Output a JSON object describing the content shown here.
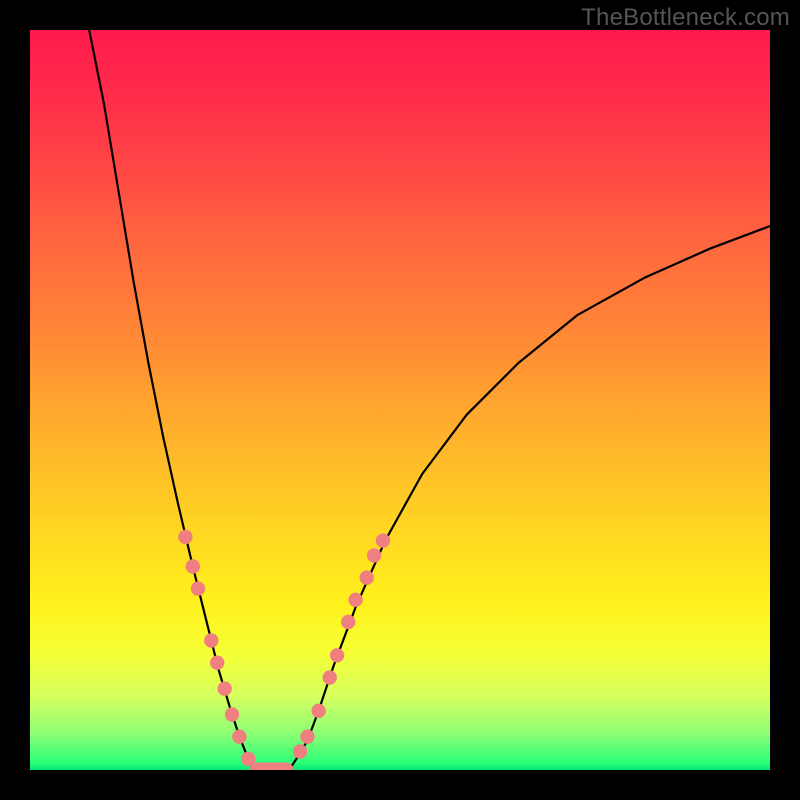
{
  "watermark": "TheBottleneck.com",
  "colors": {
    "frame": "#000000",
    "curve": "#000000",
    "dot_fill": "#f08080",
    "dot_stroke": "#d36a6a"
  },
  "chart_data": {
    "type": "line",
    "title": "",
    "xlabel": "",
    "ylabel": "",
    "xlim": [
      0,
      100
    ],
    "ylim": [
      0,
      100
    ],
    "background_gradient": {
      "orientation": "vertical",
      "stops": [
        {
          "pos": 0.0,
          "color": "#ff1a4d"
        },
        {
          "pos": 0.5,
          "color": "#ffc424"
        },
        {
          "pos": 0.82,
          "color": "#fff01c"
        },
        {
          "pos": 1.0,
          "color": "#00e676"
        }
      ]
    },
    "series": [
      {
        "name": "left-branch",
        "x": [
          8,
          10,
          12,
          14,
          16,
          18,
          20,
          22,
          24,
          25.5,
          27,
          28.3,
          29.3,
          30,
          30.5
        ],
        "y": [
          100,
          90,
          78,
          66,
          55,
          45,
          36,
          27.5,
          19.5,
          13.5,
          8.5,
          4.5,
          2,
          0.5,
          0
        ]
      },
      {
        "name": "right-branch",
        "x": [
          35,
          36,
          37.5,
          39,
          41,
          44,
          48,
          53,
          59,
          66,
          74,
          83,
          92,
          100
        ],
        "y": [
          0,
          1.5,
          4,
          8,
          14,
          22,
          31,
          40,
          48,
          55,
          61.5,
          66.5,
          70.5,
          73.5
        ]
      },
      {
        "name": "floor",
        "x": [
          30.5,
          35
        ],
        "y": [
          0,
          0
        ]
      }
    ],
    "markers": {
      "name": "series-dots",
      "left": [
        {
          "x": 21.0,
          "y": 31.5
        },
        {
          "x": 22.0,
          "y": 27.5
        },
        {
          "x": 22.7,
          "y": 24.5
        },
        {
          "x": 24.5,
          "y": 17.5
        },
        {
          "x": 25.3,
          "y": 14.5
        },
        {
          "x": 26.3,
          "y": 11.0
        },
        {
          "x": 27.3,
          "y": 7.5
        },
        {
          "x": 28.3,
          "y": 4.5
        },
        {
          "x": 29.5,
          "y": 1.5
        }
      ],
      "bottom": [
        {
          "x": 30.7,
          "y": 0.0
        },
        {
          "x": 32.0,
          "y": 0.0
        },
        {
          "x": 33.3,
          "y": 0.0
        },
        {
          "x": 34.6,
          "y": 0.0
        }
      ],
      "right": [
        {
          "x": 36.5,
          "y": 2.5
        },
        {
          "x": 37.5,
          "y": 4.5
        },
        {
          "x": 39.0,
          "y": 8.0
        },
        {
          "x": 40.5,
          "y": 12.5
        },
        {
          "x": 41.5,
          "y": 15.5
        },
        {
          "x": 43.0,
          "y": 20.0
        },
        {
          "x": 44.0,
          "y": 23.0
        },
        {
          "x": 45.5,
          "y": 26.0
        },
        {
          "x": 46.5,
          "y": 29.0
        },
        {
          "x": 47.7,
          "y": 31.0
        }
      ]
    }
  }
}
